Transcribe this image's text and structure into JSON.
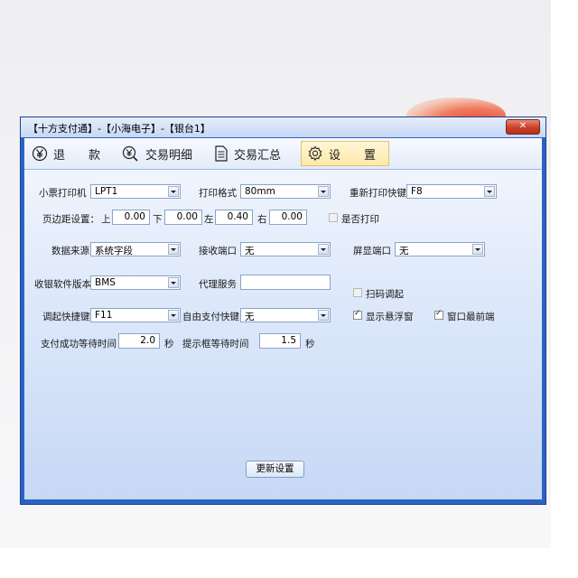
{
  "window": {
    "title": "【十方支付通】-【小海电子】-【银台1】",
    "close_icon": "close-icon"
  },
  "toolbar": {
    "refund": {
      "icon": "yen-icon",
      "char1": "退",
      "char2": "款"
    },
    "details": {
      "icon": "yen-search-icon",
      "label": "交易明细"
    },
    "summary": {
      "icon": "document-icon",
      "label": "交易汇总"
    },
    "settings": {
      "icon": "gear-icon",
      "char1": "设",
      "char2": "置"
    }
  },
  "form": {
    "receipt_printer": {
      "label": "小票打印机",
      "value": "LPT1"
    },
    "print_format": {
      "label": "打印格式",
      "value": "80mm"
    },
    "reprint_hotkey": {
      "label": "重新打印快键",
      "value": "F8"
    },
    "margins": {
      "label": "页边距设置：",
      "top_label": "上",
      "top": "0.00",
      "bottom_label": "下",
      "bottom": "0.00",
      "left_label": "左",
      "left": "0.40",
      "right_label": "右",
      "right": "0.00"
    },
    "print_enabled": {
      "label": "是否打印",
      "checked": false
    },
    "data_source": {
      "label": "数据来源",
      "value": "系统字段"
    },
    "receive_port": {
      "label": "接收端口",
      "value": "无"
    },
    "display_port": {
      "label": "屏显端口",
      "value": "无"
    },
    "cashier_version": {
      "label": "收银软件版本",
      "value": "BMS"
    },
    "proxy_service": {
      "label": "代理服务",
      "value": ""
    },
    "scan_adjust": {
      "label": "扫码调起",
      "checked": false
    },
    "invoke_hotkey": {
      "label": "调起快捷键",
      "value": "F11"
    },
    "free_pay_hotkey": {
      "label": "自由支付快键",
      "value": "无"
    },
    "show_floating": {
      "label": "显示悬浮窗",
      "checked": true
    },
    "window_topmost": {
      "label": "窗口最前端",
      "checked": true
    },
    "success_wait": {
      "label": "支付成功等待时间",
      "value": "2.0",
      "unit": "秒"
    },
    "prompt_wait": {
      "label": "提示框等待时间",
      "value": "1.5",
      "unit": "秒"
    }
  },
  "actions": {
    "update_label": "更新设置"
  },
  "colors": {
    "frame": "#2b63c4",
    "client": "#dde8fa",
    "active_tab": "#fde9a8"
  }
}
